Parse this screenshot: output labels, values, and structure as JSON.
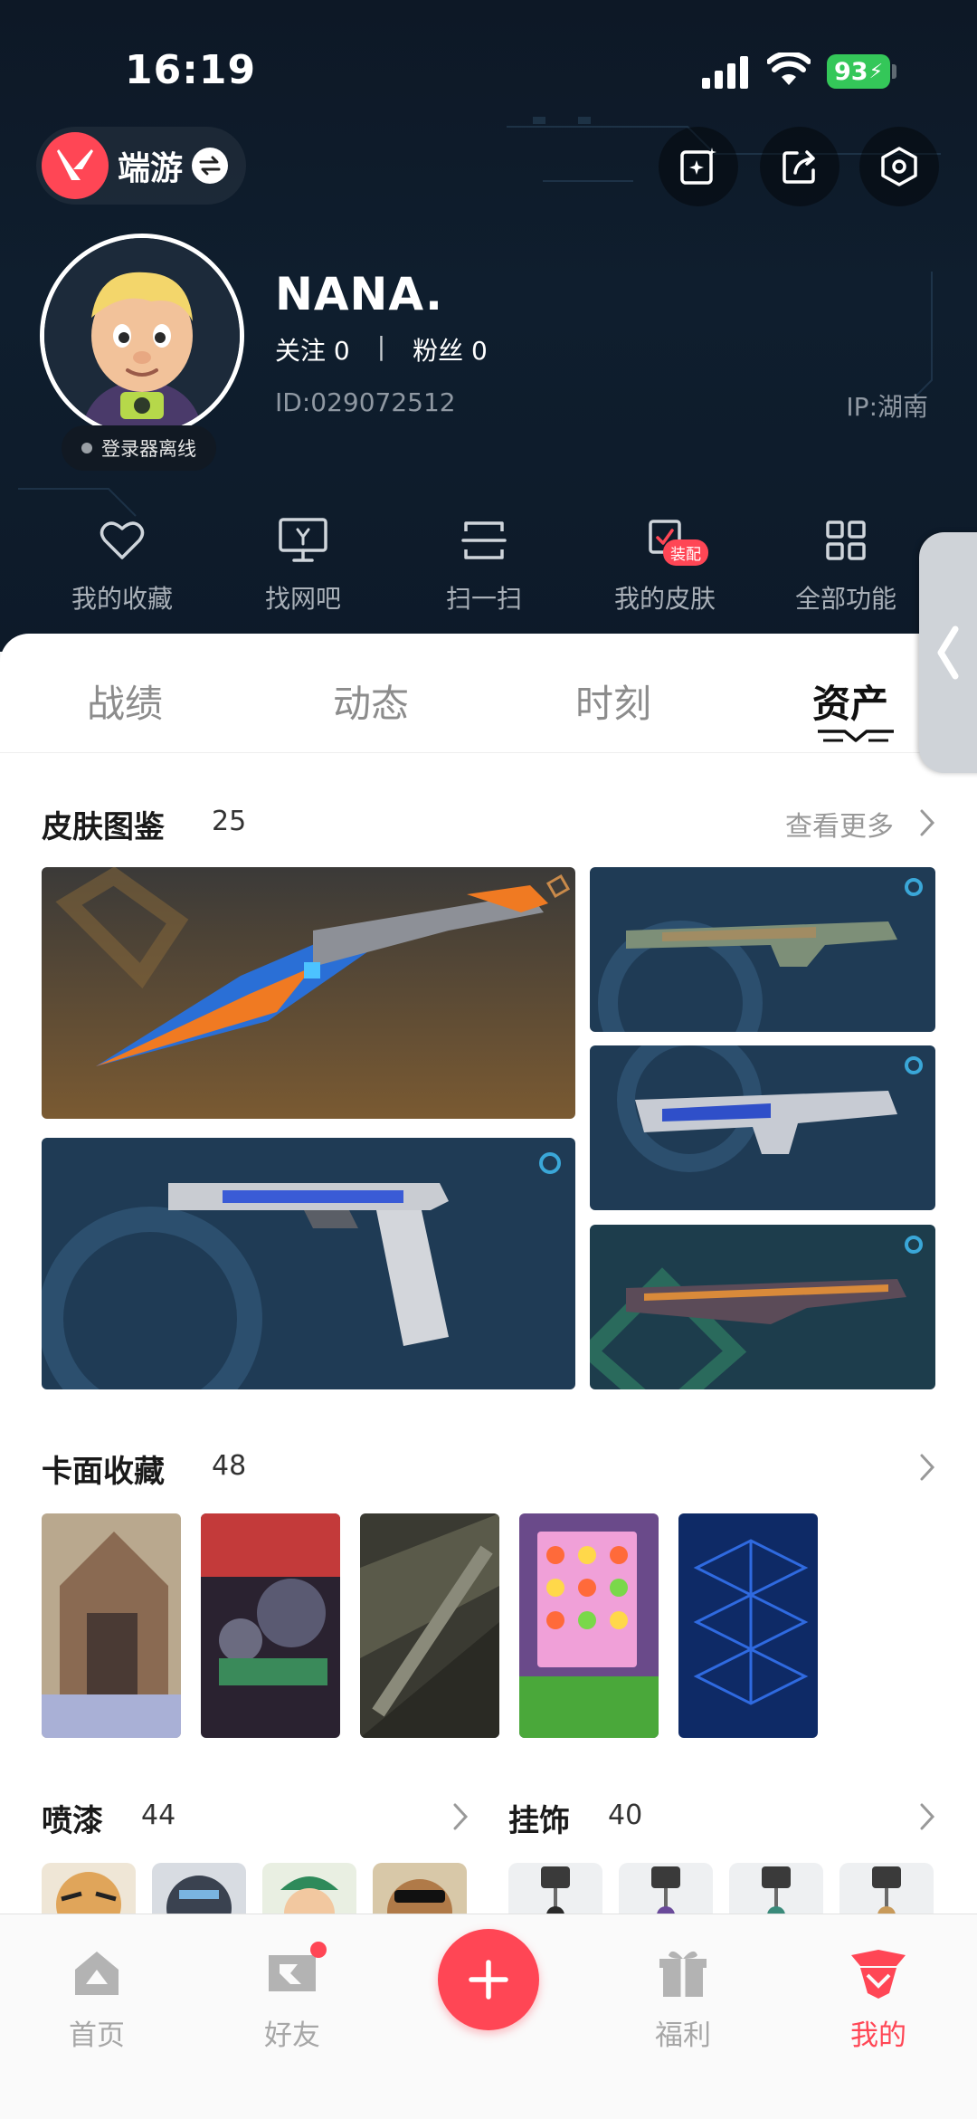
{
  "status_bar": {
    "time": "16:19",
    "battery": "93"
  },
  "header": {
    "app_name": "端游",
    "profile": {
      "nickname": "NANA.",
      "follow_label": "关注 0",
      "fans_label": "粉丝 0",
      "separator": "|",
      "id": "ID:029072512",
      "ip": "IP:湖南",
      "launcher_status": "登录器离线"
    },
    "quick_actions": [
      {
        "label": "我的收藏",
        "icon": "heart-icon"
      },
      {
        "label": "找网吧",
        "icon": "monitor-icon"
      },
      {
        "label": "扫一扫",
        "icon": "scan-icon"
      },
      {
        "label": "我的皮肤",
        "icon": "skin-icon",
        "badge": "装配"
      },
      {
        "label": "全部功能",
        "icon": "grid-icon"
      }
    ]
  },
  "tabs": [
    "战绩",
    "动态",
    "时刻",
    "资产"
  ],
  "active_tab": "资产",
  "sections": {
    "skins": {
      "title": "皮肤图鉴",
      "count": "25",
      "more": "查看更多"
    },
    "cards": {
      "title": "卡面收藏",
      "count": "48"
    },
    "sprays": {
      "title": "喷漆",
      "count": "44"
    },
    "charms": {
      "title": "挂饰",
      "count": "40"
    }
  },
  "bottom_nav": [
    {
      "label": "首页",
      "icon": "home-icon"
    },
    {
      "label": "好友",
      "icon": "friends-icon",
      "has_dot": true
    },
    {
      "label": "",
      "icon": "plus-icon"
    },
    {
      "label": "福利",
      "icon": "gift-icon"
    },
    {
      "label": "我的",
      "icon": "profile-icon",
      "active": true
    }
  ],
  "colors": {
    "accent": "#ff4655",
    "header_bg": "#0f1e2e",
    "battery": "#34c759"
  }
}
